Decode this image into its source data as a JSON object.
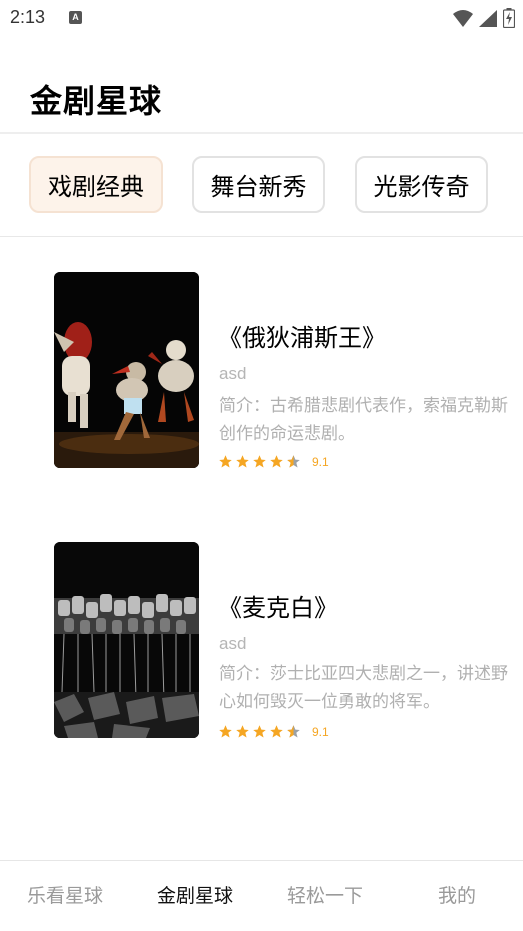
{
  "status_bar": {
    "time": "2:13",
    "notification_icon": "a-icon",
    "icons": [
      "wifi-icon",
      "signal-icon",
      "battery-charging-icon"
    ]
  },
  "header": {
    "title": "金剧星球"
  },
  "tabs": [
    {
      "label": "戏剧经典",
      "active": true
    },
    {
      "label": "舞台新秀",
      "active": false
    },
    {
      "label": "光影传奇",
      "active": false
    }
  ],
  "cards": [
    {
      "title": "《俄狄浦斯王》",
      "subtitle": "asd",
      "description": "简介：古希腊悲剧代表作，索福克勒斯创作的命运悲剧。",
      "rating": "9.1",
      "stars": 4.5,
      "poster": "dancers-on-stage"
    },
    {
      "title": "《麦克白》",
      "subtitle": "asd",
      "description": "简介：莎士比亚四大悲剧之一，讲述野心如何毁灭一位勇敢的将军。",
      "rating": "9.1",
      "stars": 4.5,
      "poster": "masks-installation"
    }
  ],
  "bottom_nav": [
    {
      "label": "乐看星球",
      "active": false
    },
    {
      "label": "金剧星球",
      "active": true
    },
    {
      "label": "轻松一下",
      "active": false
    },
    {
      "label": "我的",
      "active": false
    }
  ],
  "colors": {
    "accent_star": "#f5a623",
    "active_tab_bg": "#fdf3ea",
    "muted_text": "#b0b0b0"
  }
}
